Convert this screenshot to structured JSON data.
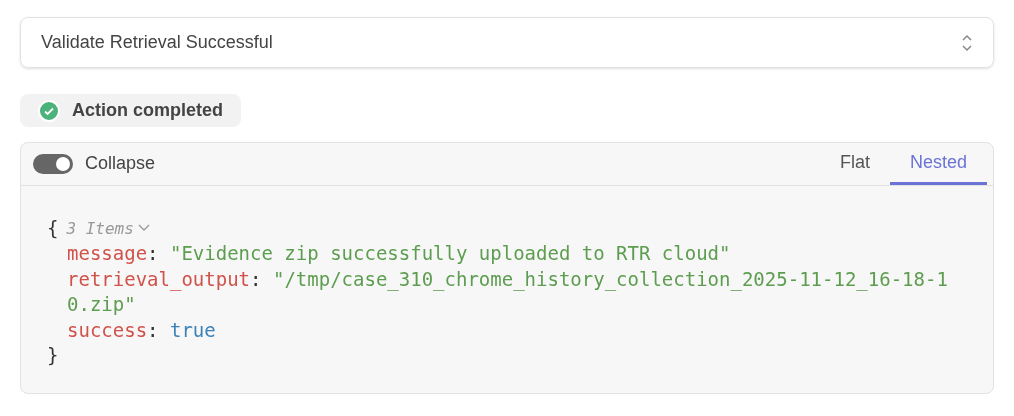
{
  "select": {
    "value": "Validate Retrieval Successful"
  },
  "status": {
    "label": "Action completed",
    "completed": true
  },
  "viewer": {
    "toggle": {
      "label": "Collapse",
      "on": true
    },
    "tabs": [
      {
        "label": "Flat",
        "selected": false
      },
      {
        "label": "Nested",
        "selected": true
      }
    ],
    "separator": ":",
    "open_brace": "{",
    "close_brace": "}",
    "count": "3 Items",
    "expanded": true,
    "entries": [
      {
        "key": "message",
        "value": "\"Evidence zip successfully uploaded to RTR cloud\"",
        "kind": "string"
      },
      {
        "key": "retrieval_output",
        "value": "\"/tmp/case_310_chrome_history_collection_2025-11-12_16-18-10.zip\"",
        "kind": "string"
      },
      {
        "key": "success",
        "value": "true",
        "kind": "boolean"
      }
    ]
  }
}
